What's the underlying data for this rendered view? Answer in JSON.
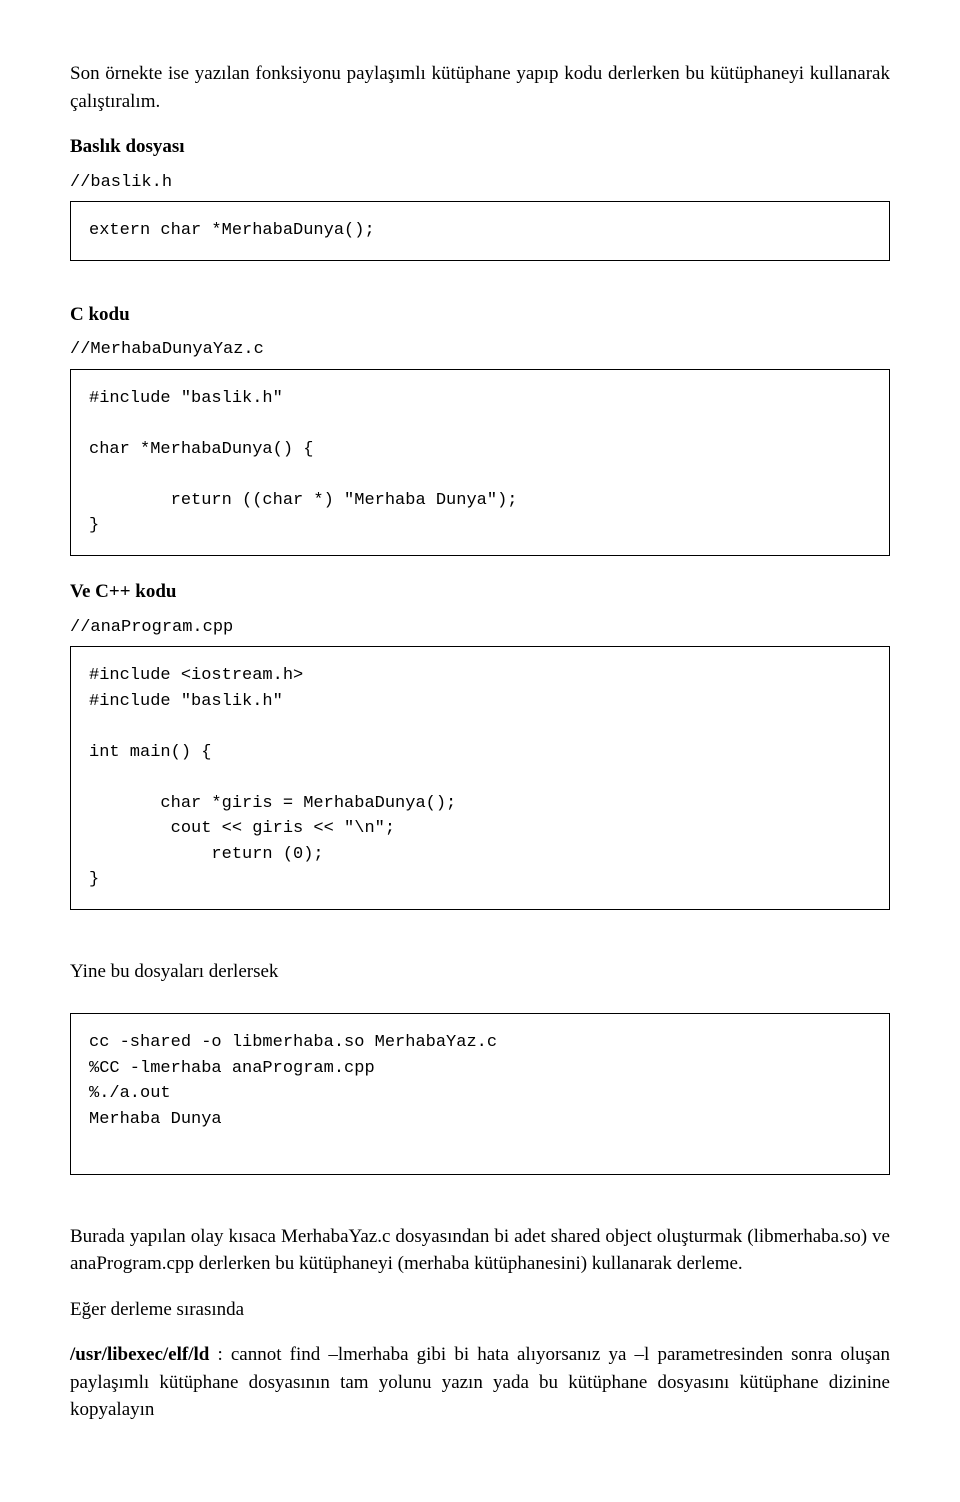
{
  "p1": "Son örnekte ise yazılan fonksiyonu paylaşımlı kütüphane yapıp kodu derlerken bu kütüphaneyi kullanarak çalıştıralım.",
  "h_baslik": "Baslık dosyası",
  "cm_baslik": "//baslik.h",
  "code_baslik": "extern char *MerhabaDunya();",
  "h_ckodu": "C kodu",
  "cm_ckodu": "//MerhabaDunyaYaz.c",
  "code_ckodu": "#include \"baslik.h\"\n\nchar *MerhabaDunya() {\n\n        return ((char *) \"Merhaba Dunya\");\n}",
  "h_cpp": "Ve C++ kodu",
  "cm_cpp": "//anaProgram.cpp",
  "code_cpp": "#include <iostream.h>\n#include \"baslik.h\"\n\nint main() {\n\n       char *giris = MerhabaDunya();\n        cout << giris << \"\\n\";\n            return (0);\n}",
  "h_comp": "Yine bu dosyaları derlersek",
  "code_comp": "cc -shared -o libmerhaba.so MerhabaYaz.c\n%CC -lmerhaba anaProgram.cpp\n%./a.out\nMerhaba Dunya\n\n",
  "p2": "Burada yapılan olay kısaca MerhabaYaz.c dosyasından bi adet shared object oluşturmak (libmerhaba.so) ve anaProgram.cpp derlerken bu kütüphaneyi (merhaba kütüphanesini) kullanarak derleme.",
  "p3": "Eğer derleme sırasında",
  "p4_bold": "/usr/libexec/elf/ld",
  "p4_rest": " : cannot find –lmerhaba gibi bi hata alıyorsanız ya –l parametresinden sonra oluşan paylaşımlı kütüphane dosyasının tam yolunu yazın yada bu kütüphane dosyasını kütüphane dizinine kopyalayın"
}
